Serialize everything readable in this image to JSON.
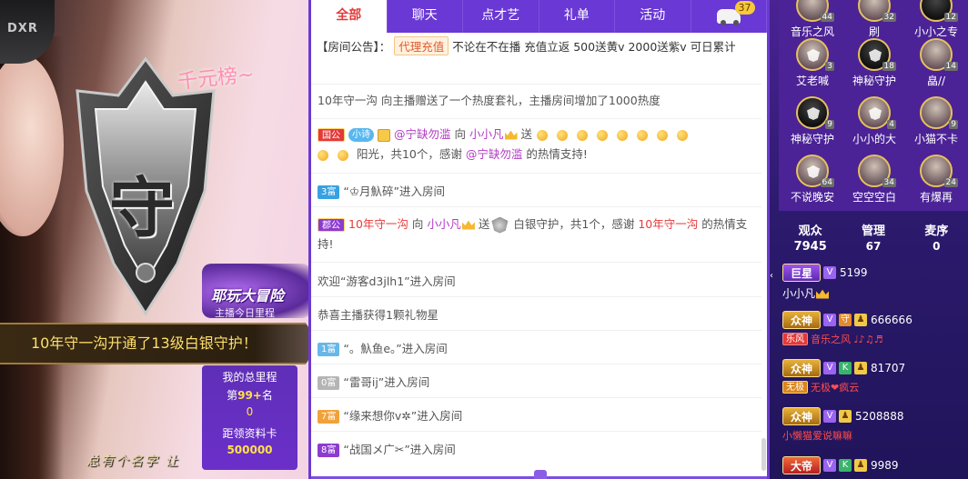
{
  "video": {
    "headset_text": "DXR",
    "rank_text": "千元榜~",
    "shield_char": "守",
    "adventure_title": "耶玩大冒险",
    "adventure_sub": "主播今日里程",
    "banner_text": "10年守一沟开通了13级白银守护！",
    "mileage": {
      "label": "我的总里程",
      "rank_prefix": "第",
      "rank_value": "99+",
      "rank_suffix": "名",
      "count": "0",
      "card_label": "距领资料卡",
      "card_value": "500000"
    },
    "caption": "总有个名字 让"
  },
  "chat": {
    "tabs": [
      {
        "label": "全部",
        "active": true
      },
      {
        "label": "聊天",
        "active": false
      },
      {
        "label": "点才艺",
        "active": false
      },
      {
        "label": "礼单",
        "active": false
      },
      {
        "label": "活动",
        "active": false
      }
    ],
    "car_badge": "37",
    "notice": {
      "prefix": "【房间公告】：",
      "tag": "代理充值",
      "text": "不论在不在播 充值立返 500送黄v 2000送紫v 可日累计"
    },
    "messages": {
      "m1": "10年守一沟 向主播赠送了一个热度套礼，主播房间增加了1000热度",
      "m2": {
        "badge": "国公",
        "heart_badge": "小诗",
        "user": "@宁缺勿滥",
        "to": "向",
        "target": "小小凡",
        "send": "送",
        "tail1": "阳光，共10个，感谢",
        "user2": "@宁缺勿滥",
        "tail2": "的热情支持!"
      },
      "m3": {
        "badge": "3富",
        "text": "“♔月魞碎”进入房间"
      },
      "m4": {
        "badge": "郡公",
        "user": "10年守一沟",
        "to": "向",
        "target": "小小凡",
        "send": "送",
        "gift": "白银守护，共1个，感谢",
        "user2": "10年守一沟",
        "tail": "的热情支持!"
      },
      "m5": "欢迎“游客d3jlh1”进入房间",
      "m6": "恭喜主播获得1颗礼物星",
      "m7": {
        "badge": "1富",
        "text": "“。魞鱼e。”进入房间"
      },
      "m8": {
        "badge": "0富",
        "text": "“雷哥ij”进入房间"
      },
      "m9": {
        "badge": "7富",
        "text": "“缘来想你v✲”进入房间"
      },
      "m10": {
        "badge": "8富",
        "text": "“战国メ广✂”进入房间"
      }
    }
  },
  "right": {
    "fans": [
      {
        "name": "音乐之风",
        "lvl": "44"
      },
      {
        "name": "刷",
        "lvl": "32"
      },
      {
        "name": "小小之专",
        "lvl": "12"
      },
      {
        "name": "艾老喊",
        "lvl": "3"
      },
      {
        "name": "神秘守护",
        "lvl": "18"
      },
      {
        "name": "皛//",
        "lvl": "14"
      },
      {
        "name": "神秘守护",
        "lvl": "9"
      },
      {
        "name": "小小的大",
        "lvl": "4"
      },
      {
        "name": "小猫不卡",
        "lvl": "9"
      },
      {
        "name": "不说晚安",
        "lvl": "64"
      },
      {
        "name": "空空空白",
        "lvl": "34"
      },
      {
        "name": "有爆再",
        "lvl": "24"
      }
    ],
    "stats": [
      {
        "title": "观众",
        "value": "7945"
      },
      {
        "title": "管理",
        "value": "67"
      },
      {
        "title": "麦序",
        "value": "0"
      }
    ],
    "viewers": [
      {
        "rank": "巨星",
        "num": "5199",
        "name": "小小凡"
      },
      {
        "rank": "众神",
        "num": "666666",
        "tag": "乐风",
        "name2": "音乐之风 ♩♪♫♬"
      },
      {
        "rank": "众神",
        "num": "81707",
        "tag": "无极",
        "name2": "无极❤疯云"
      },
      {
        "rank": "众神",
        "num": "5208888",
        "name2": "小懒猫爱说嘛嘛"
      },
      {
        "rank": "大帝",
        "num": "9989"
      }
    ]
  }
}
